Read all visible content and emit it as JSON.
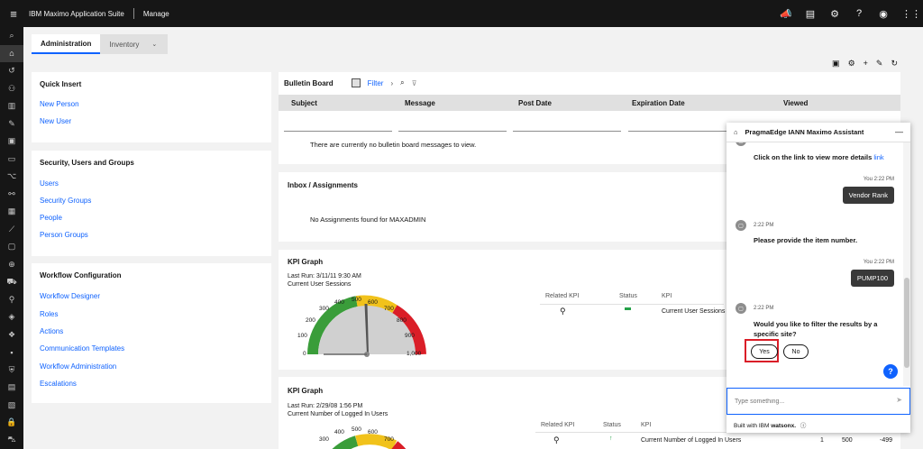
{
  "topbar": {
    "brand": "IBM Maximo Application Suite",
    "product": "Manage",
    "icons": [
      "megaphone-icon",
      "clipboard-icon",
      "settings-icon",
      "help-icon",
      "user-icon",
      "apps-icon"
    ]
  },
  "tabs": [
    {
      "label": "Administration",
      "active": true
    },
    {
      "label": "Inventory",
      "active": false
    }
  ],
  "quick_insert": {
    "title": "Quick Insert",
    "links": [
      "New Person",
      "New User"
    ]
  },
  "security": {
    "title": "Security, Users and Groups",
    "links": [
      "Users",
      "Security Groups",
      "People",
      "Person Groups"
    ]
  },
  "workflow": {
    "title": "Workflow Configuration",
    "links": [
      "Workflow Designer",
      "Roles",
      "Actions",
      "Communication Templates",
      "Workflow Administration",
      "Escalations"
    ]
  },
  "bulletin": {
    "title": "Bulletin Board",
    "filter_label": "Filter",
    "columns": [
      "Subject",
      "Message",
      "Post Date",
      "Expiration Date",
      "Viewed"
    ],
    "empty": "There are currently no bulletin board messages to view."
  },
  "inbox": {
    "title": "Inbox / Assignments",
    "empty": "No Assignments found for MAXADMIN"
  },
  "kpi1": {
    "title": "KPI Graph",
    "last_run": "Last Run: 3/11/11 9:30 AM",
    "subtitle": "Current User Sessions",
    "gauge_labels": [
      "0",
      "100",
      "200",
      "300",
      "400",
      "500",
      "600",
      "700",
      "800",
      "900",
      "1,000"
    ],
    "value": 500,
    "col_related": "Related KPI",
    "col_status": "Status",
    "col_kpi": "KPI",
    "kpi_name": "Current User Sessions"
  },
  "kpi2": {
    "title": "KPI Graph",
    "last_run": "Last Run: 2/29/08 1:56 PM",
    "subtitle": "Current Number of Logged In Users",
    "gauge_labels": [
      "300",
      "400",
      "500",
      "600",
      "700"
    ],
    "col_related": "Related KPI",
    "col_status": "Status",
    "col_kpi": "KPI",
    "kpi_name": "Current Number of Logged In Users",
    "v1": "1",
    "v2": "500",
    "v3": "-499"
  },
  "chat": {
    "title": "PragmaEdge IANN Maximo Assistant",
    "link_msg": "Click on the link to view more details",
    "link_word": "link",
    "ts_you1": "You 2:22 PM",
    "bubble1": "Vendor Rank",
    "ts_bot1": "2:22 PM",
    "bot_msg1": "Please provide the item number.",
    "ts_you2": "You 2:22 PM",
    "bubble2": "PUMP100",
    "ts_bot2": "2:22 PM",
    "bot_msg2": "Would you like to filter the results by a specific site?",
    "yes": "Yes",
    "no": "No",
    "placeholder": "Type something...",
    "footer_pre": "Built with IBM",
    "footer_brand": "watsonx."
  },
  "colors": {
    "accent": "#0f62fe",
    "topbar": "#161616",
    "gauge_green": "#3a9d3a",
    "gauge_yellow": "#f1c21b",
    "gauge_red": "#da1e28",
    "highlight": "#da1e28"
  }
}
